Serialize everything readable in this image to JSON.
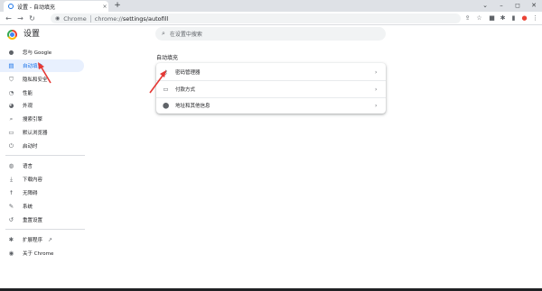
{
  "tab": {
    "title": "设置 - 自动填充",
    "close": "×",
    "new": "+"
  },
  "window": {
    "minimize": "–",
    "maximize": "◻",
    "close": "✕",
    "dropdown": "⌄"
  },
  "toolbar": {
    "back": "←",
    "forward": "→",
    "reload": "↻",
    "chip": "Chrome",
    "url_prefix": "chrome://",
    "url_path": "settings/autofill"
  },
  "header": {
    "title": "设置",
    "search_placeholder": "在设置中搜索"
  },
  "sidebar": {
    "items": [
      {
        "label": "您与 Google",
        "icon": "person-icon"
      },
      {
        "label": "自动填充",
        "icon": "autofill-icon",
        "active": true
      },
      {
        "label": "隐私和安全",
        "icon": "shield-icon"
      },
      {
        "label": "性能",
        "icon": "performance-icon"
      },
      {
        "label": "外观",
        "icon": "palette-icon"
      },
      {
        "label": "搜索引擎",
        "icon": "search-icon"
      },
      {
        "label": "默认浏览器",
        "icon": "browser-icon"
      },
      {
        "label": "启动时",
        "icon": "power-icon"
      },
      {
        "label": "语言",
        "icon": "globe-icon"
      },
      {
        "label": "下载内容",
        "icon": "download-icon"
      },
      {
        "label": "无障碍",
        "icon": "accessibility-icon"
      },
      {
        "label": "系统",
        "icon": "wrench-icon"
      },
      {
        "label": "重置设置",
        "icon": "reset-icon"
      },
      {
        "label": "扩展程序",
        "icon": "puzzle-icon"
      },
      {
        "label": "关于 Chrome",
        "icon": "chrome-icon"
      }
    ]
  },
  "main": {
    "section_title": "自动填充",
    "rows": [
      {
        "label": "密码管理器",
        "icon": "key-icon"
      },
      {
        "label": "付款方式",
        "icon": "card-icon"
      },
      {
        "label": "地址和其他信息",
        "icon": "location-icon"
      }
    ]
  },
  "colors": {
    "accent": "#1a73e8",
    "active_bg": "#e8f0fe",
    "arrow": "#e53935"
  }
}
